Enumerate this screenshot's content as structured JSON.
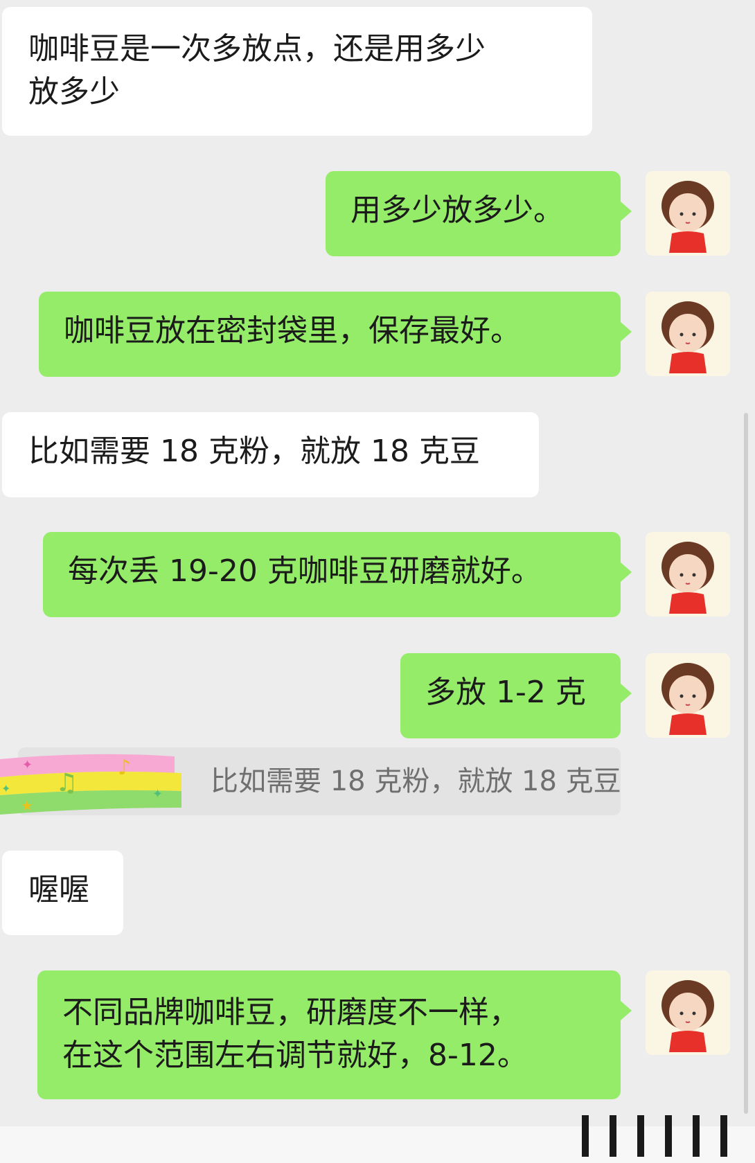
{
  "messages": [
    {
      "side": "left",
      "text": "咖啡豆是一次多放点，还是用多少\n放多少"
    },
    {
      "side": "right",
      "text": "用多少放多少。"
    },
    {
      "side": "right",
      "text": "咖啡豆放在密封袋里，保存最好。"
    },
    {
      "side": "left",
      "text": "比如需要 18 克粉，就放 18 克豆"
    },
    {
      "side": "right",
      "text": "每次丢 19-20 克咖啡豆研磨就好。"
    },
    {
      "side": "right",
      "text": "多放 1-2 克"
    },
    {
      "side": "quote",
      "text": "比如需要 18 克粉，就放 18 克豆"
    },
    {
      "side": "left",
      "text": "喔喔"
    },
    {
      "side": "right",
      "text": "不同品牌咖啡豆，研磨度不一样，\n在这个范围左右调节就好，8-12。"
    }
  ],
  "colors": {
    "background": "#ededed",
    "incoming_bubble": "#ffffff",
    "outgoing_bubble": "#95ec69",
    "quote_bubble": "#e3e3e3"
  },
  "icons": {
    "avatar": "cartoon-girl-avatar-icon",
    "decoration": "rainbow-music-stripe-icon"
  }
}
